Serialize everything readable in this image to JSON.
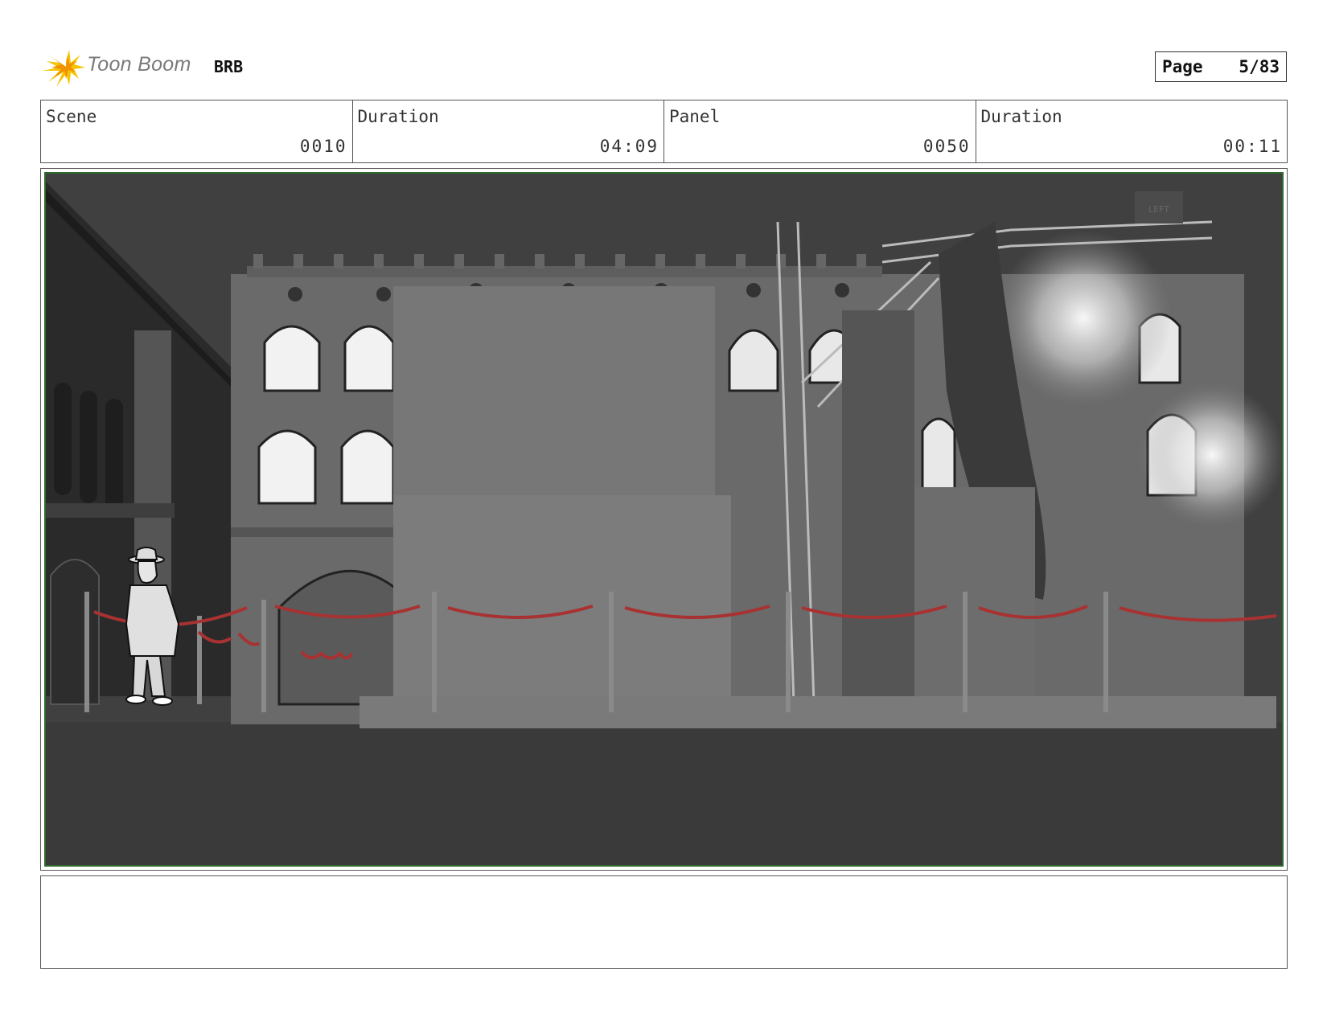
{
  "header": {
    "logo_text": "Toon Boom",
    "project": "BRB",
    "page_label": "Page",
    "page_value": "5/83"
  },
  "info": {
    "scene_label": "Scene",
    "scene_value": "0010",
    "scene_duration_label": "Duration",
    "scene_duration_value": "04:09",
    "panel_label": "Panel",
    "panel_value": "0050",
    "panel_duration_label": "Duration",
    "panel_duration_value": "00:11"
  },
  "panel": {
    "sign_text": "LEFT",
    "frame_color": "#2e6b2e",
    "rope_color": "#a83232"
  },
  "notes": {
    "text": ""
  }
}
